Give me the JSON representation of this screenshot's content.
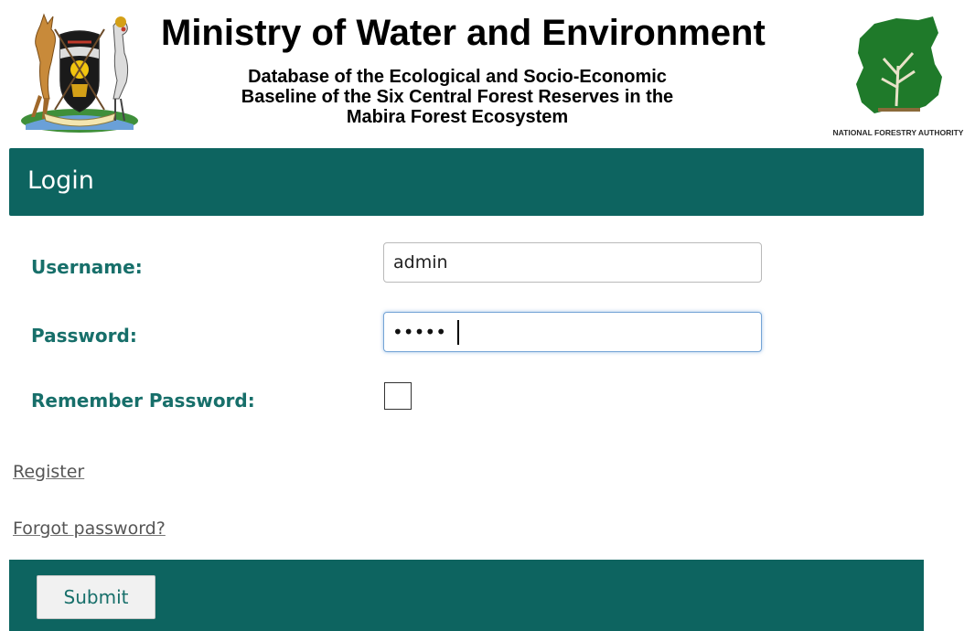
{
  "header": {
    "title": "Ministry of Water and Environment",
    "subtitle_lines": [
      "Database of the Ecological and Socio-Economic",
      "Baseline of the Six Central Forest Reserves in the",
      "Mabira Forest Ecosystem"
    ],
    "left_logo": "uganda-coat-of-arms",
    "right_logo": "national-forestry-authority-logo",
    "right_logo_text": "NATIONAL FORESTRY AUTHORITY"
  },
  "login": {
    "title": "Login",
    "username_label": "Username:",
    "username_value": "admin",
    "password_label": "Password:",
    "password_masked": "•••••",
    "remember_label": "Remember Password:",
    "remember_checked": false
  },
  "links": {
    "register": "Register",
    "forgot": "Forgot password?"
  },
  "footer": {
    "submit_label": "Submit"
  },
  "colors": {
    "bar": "#0d6460",
    "label_text": "#176f6a"
  }
}
